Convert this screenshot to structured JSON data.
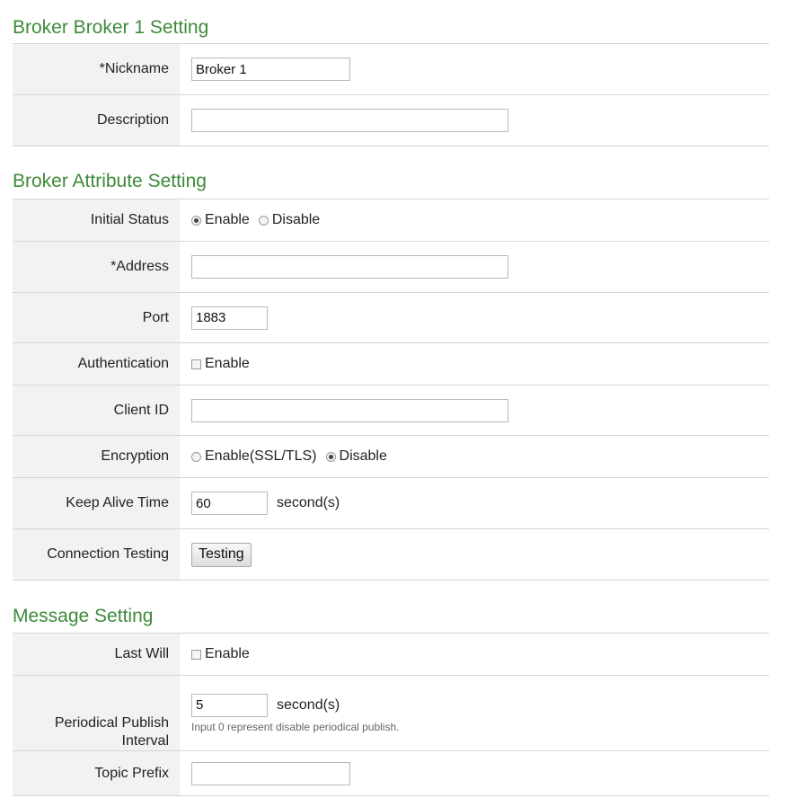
{
  "broker_section": {
    "title": "Broker Broker 1 Setting",
    "nickname": {
      "label": "*Nickname",
      "value": "Broker 1",
      "placeholder": ""
    },
    "description": {
      "label": "Description",
      "value": "",
      "placeholder": ""
    }
  },
  "attribute_section": {
    "title": "Broker Attribute Setting",
    "initial_status": {
      "label": "Initial Status",
      "options": [
        "Enable",
        "Disable"
      ],
      "selected": "Enable"
    },
    "address": {
      "label": "*Address",
      "value": ""
    },
    "port": {
      "label": "Port",
      "value": "1883"
    },
    "authentication": {
      "label": "Authentication",
      "checkbox_label": "Enable",
      "checked": false
    },
    "client_id": {
      "label": "Client ID",
      "value": ""
    },
    "encryption": {
      "label": "Encryption",
      "options": [
        "Enable(SSL/TLS)",
        "Disable"
      ],
      "selected": "Disable"
    },
    "keep_alive": {
      "label": "Keep Alive Time",
      "value": "60",
      "unit": "second(s)"
    },
    "connection_testing": {
      "label": "Connection Testing",
      "button": "Testing"
    }
  },
  "message_section": {
    "title": "Message Setting",
    "last_will": {
      "label": "Last Will",
      "checkbox_label": "Enable",
      "checked": false
    },
    "periodical": {
      "label_line1": "Periodical Publish",
      "label_line2": "Interval",
      "value": "5",
      "unit": "second(s)",
      "hint": "Input 0 represent disable periodical publish."
    },
    "topic_prefix": {
      "label": "Topic Prefix",
      "value": ""
    }
  },
  "colors": {
    "section_title": "#3f8a3a",
    "label_bg": "#f2f2f2",
    "row_border": "#d6d6d6"
  }
}
